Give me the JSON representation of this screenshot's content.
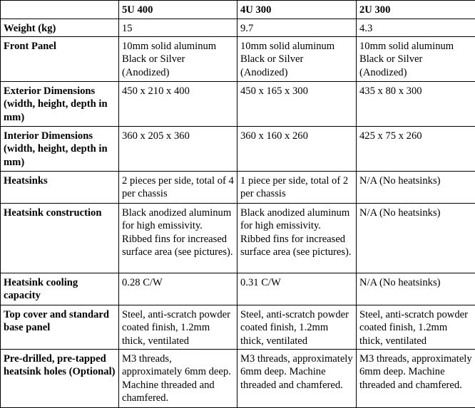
{
  "table": {
    "columns": [
      "",
      "5U 400",
      "4U 300",
      "2U 300"
    ],
    "rows": [
      {
        "label": "Weight (kg)",
        "values": [
          "15",
          "9.7",
          "4.3"
        ]
      },
      {
        "label": "Front Panel",
        "values": [
          "10mm solid aluminum Black or Silver (Anodized)",
          "10mm solid aluminum Black or Silver (Anodized)",
          "10mm solid aluminum Black or Silver (Anodized)"
        ]
      },
      {
        "label": "Exterior Dimensions (width, height, depth in mm)",
        "values": [
          "450 x 210 x 400",
          "450 x 165 x 300",
          "435 x 80 x 300"
        ]
      },
      {
        "label": "Interior Dimensions (width, height, depth in mm)",
        "values": [
          "360 x 205 x 360",
          "360 x 160 x 260",
          "425 x 75 x 260"
        ]
      },
      {
        "label": "Heatsinks",
        "values": [
          "2 pieces per side, total of 4 per chassis",
          "1 piece per side, total of 2 per chassis",
          "N/A (No heatsinks)"
        ]
      },
      {
        "label": "Heatsink construction",
        "values": [
          "Black  anodized aluminum for high emissivity.  Ribbed fins for increased surface area (see pictures).",
          "Black  anodized aluminum for high emissivity.  Ribbed fins for increased surface area (see pictures).",
          "N/A (No heatsinks)"
        ]
      },
      {
        "label": "Heatsink cooling capacity",
        "values": [
          "0.28 C/W",
          "0.31 C/W",
          "N/A (No heatsinks)"
        ]
      },
      {
        "label": "Top cover and standard base panel",
        "values": [
          "Steel, anti-scratch powder coated finish, 1.2mm thick, ventilated",
          "Steel, anti-scratch powder coated finish, 1.2mm thick, ventilated",
          "Steel, anti-scratch powder coated finish, 1.2mm thick, ventilated"
        ]
      },
      {
        "label": "Pre-drilled, pre-tapped heatsink holes (Optional)",
        "values": [
          "M3 threads, approximately 6mm deep.  Machine threaded and chamfered.",
          "M3 threads, approximately 6mm deep.  Machine threaded and chamfered.",
          "M3 threads, approximately 6mm deep.  Machine threaded and chamfered."
        ]
      }
    ]
  }
}
